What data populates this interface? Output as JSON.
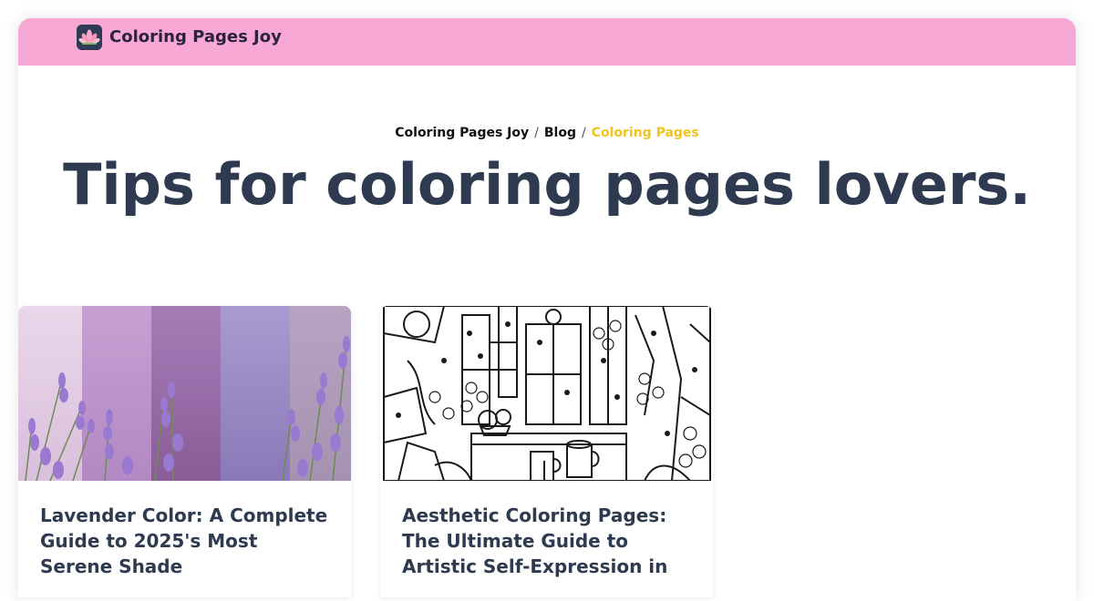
{
  "brand": {
    "name": "Coloring Pages Joy",
    "logo_icon": "lotus-icon",
    "bar_color": "#f7a8d5"
  },
  "breadcrumb": {
    "items": [
      "Coloring Pages Joy",
      "Blog"
    ],
    "current": "Coloring Pages",
    "separator": "/"
  },
  "page": {
    "title": "Tips for coloring pages lovers."
  },
  "articles": [
    {
      "title": "Lavender Color: A Complete Guide to 2025's Most Serene Shade",
      "image": "lavender-swatches-image"
    },
    {
      "title": "Aesthetic Coloring Pages: The Ultimate Guide to Artistic Self-Expression in",
      "image": "line-art-cafe-image"
    }
  ],
  "colors": {
    "title": "#2d3a50",
    "breadcrumb_current": "#f0c419"
  }
}
